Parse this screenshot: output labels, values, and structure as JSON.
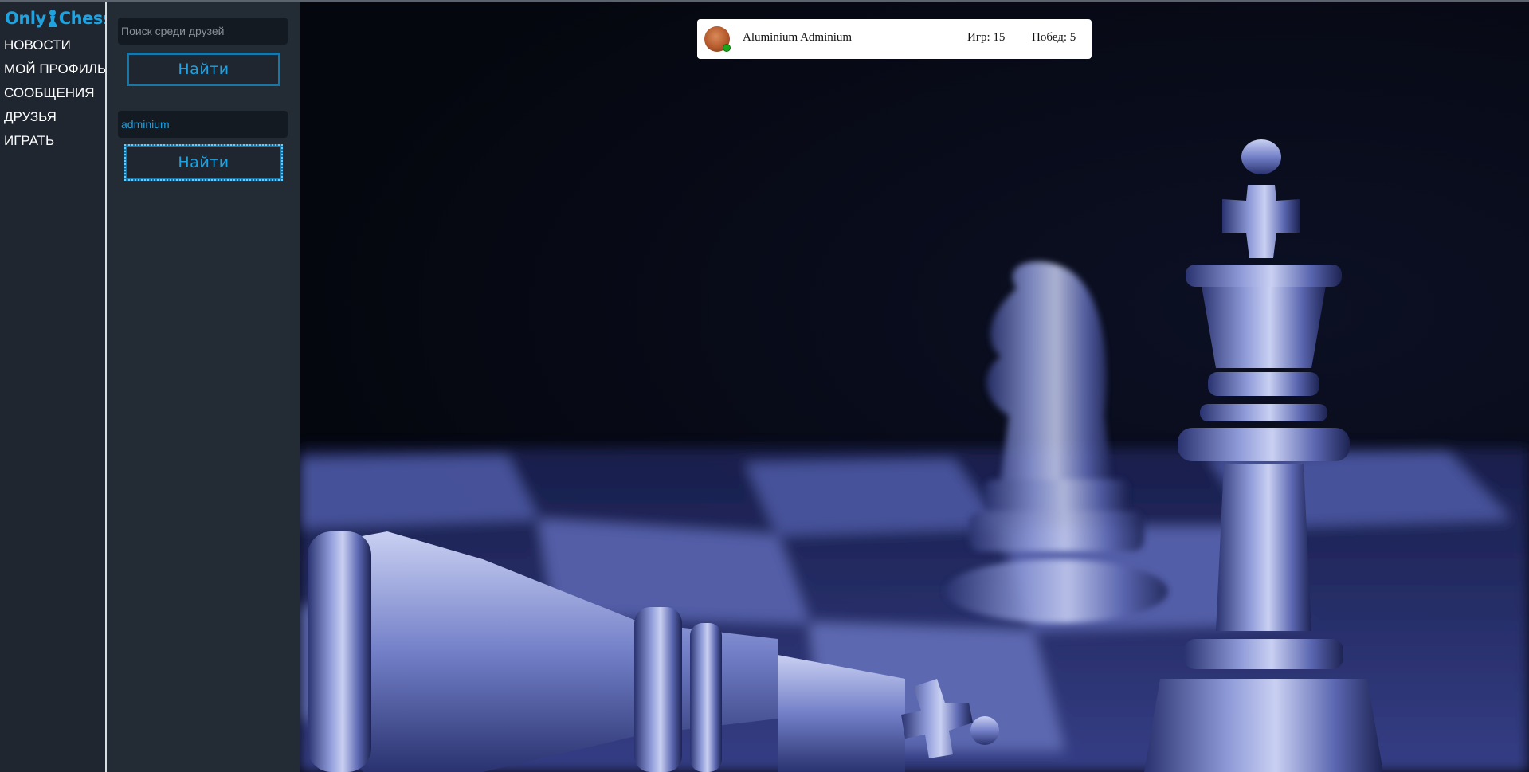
{
  "app": {
    "logo_left": "Only",
    "logo_right": "Chess"
  },
  "nav": {
    "items": [
      {
        "label": "НОВОСТИ"
      },
      {
        "label": "МОЙ ПРОФИЛЬ"
      },
      {
        "label": "СООБЩЕНИЯ"
      },
      {
        "label": "ДРУЗЬЯ"
      },
      {
        "label": "ИГРАТЬ"
      }
    ]
  },
  "friend_search": {
    "placeholder": "Поиск среди друзей",
    "value": "",
    "button_label": "Найти"
  },
  "global_search": {
    "placeholder": "",
    "value": "adminium",
    "button_label": "Найти"
  },
  "results": [
    {
      "name": "Aluminium Adminium",
      "games": "Игр: 15",
      "wins": "Побед: 5",
      "status": "online"
    }
  ],
  "colors": {
    "accent": "#1ea2e0",
    "button_border": "#1877a6",
    "sidebar_bg": "#1f2630",
    "panel_bg": "#232b35",
    "online": "#1aa51a"
  },
  "icons": {
    "logo_piece": "pawn-icon",
    "background": "chess-pieces-photo"
  }
}
